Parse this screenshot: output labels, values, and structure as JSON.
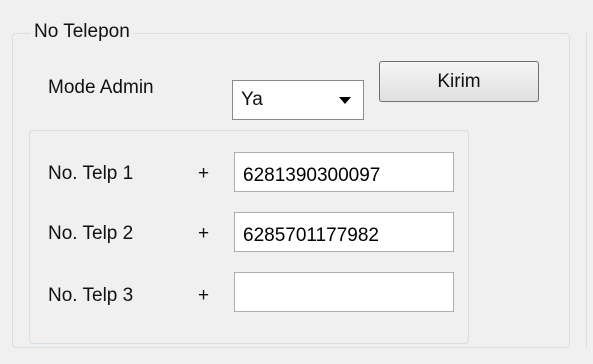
{
  "group": {
    "title": "No Telepon"
  },
  "mode_admin": {
    "label": "Mode Admin",
    "selected": "Ya"
  },
  "send_button": {
    "label": "Kirim"
  },
  "phones": [
    {
      "label": "No. Telp 1",
      "prefix": "+",
      "value": "6281390300097"
    },
    {
      "label": "No. Telp 2",
      "prefix": "+",
      "value": "6285701177982"
    },
    {
      "label": "No. Telp 3",
      "prefix": "+",
      "value": ""
    }
  ]
}
